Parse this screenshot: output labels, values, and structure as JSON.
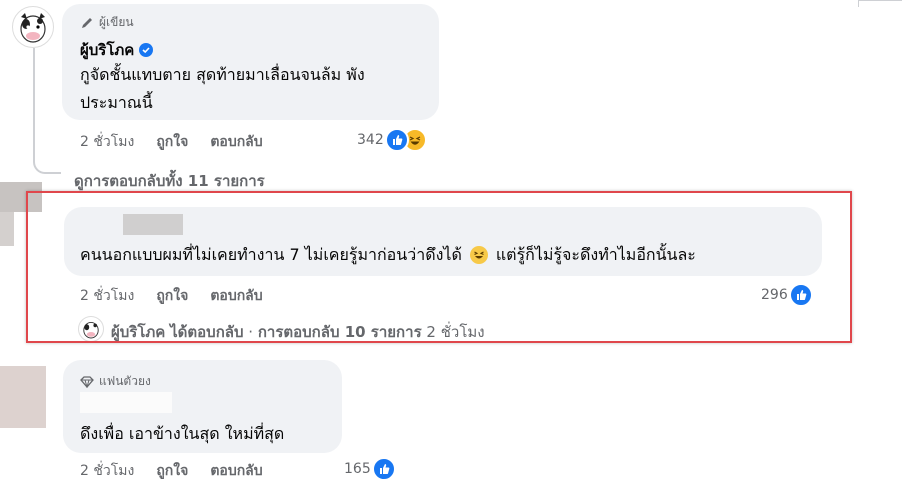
{
  "comments": [
    {
      "badge": "ผู้เขียน",
      "author": "ผู้บริโภค",
      "text_line1": "กูจัดชั้นแทบตาย สุดท้ายมาเลื่อนจนล้ม พัง",
      "text_line2": "ประมาณนี้",
      "time": "2 ชั่วโมง",
      "like": "ถูกใจ",
      "reply": "ตอบกลับ",
      "reaction_count": "342"
    },
    {
      "view_replies": "ดูการตอบกลับทั้ง 11 รายการ"
    },
    {
      "text_before_emoji": "คนนอกแบบผมที่ไม่เคยทำงาน 7 ไม่เคยรู้มาก่อนว่าดึงได้",
      "text_after_emoji": "แต่รู้ก็ไม่รู้จะดึงทำไมอีกนั้นละ",
      "time": "2 ชั่วโมง",
      "like": "ถูกใจ",
      "reply": "ตอบกลับ",
      "reaction_count": "296",
      "reply_summary": {
        "author": "ผู้บริโภค",
        "action": "ได้ตอบกลับ",
        "separator": "·",
        "count_text": "การตอบกลับ 10 รายการ",
        "time": "2 ชั่วโมง"
      }
    },
    {
      "badge": "แฟนตัวยง",
      "text": "ดึงเพื่อ เอาข้างในสุด ใหม่ที่สุด",
      "time": "2 ชั่วโมง",
      "like": "ถูกใจ",
      "reply": "ตอบกลับ",
      "reaction_count": "165"
    }
  ],
  "colors": {
    "bubble": "#f0f2f5",
    "highlight": "#e0474c",
    "like": "#1877f2",
    "secondary_text": "#65676b"
  }
}
